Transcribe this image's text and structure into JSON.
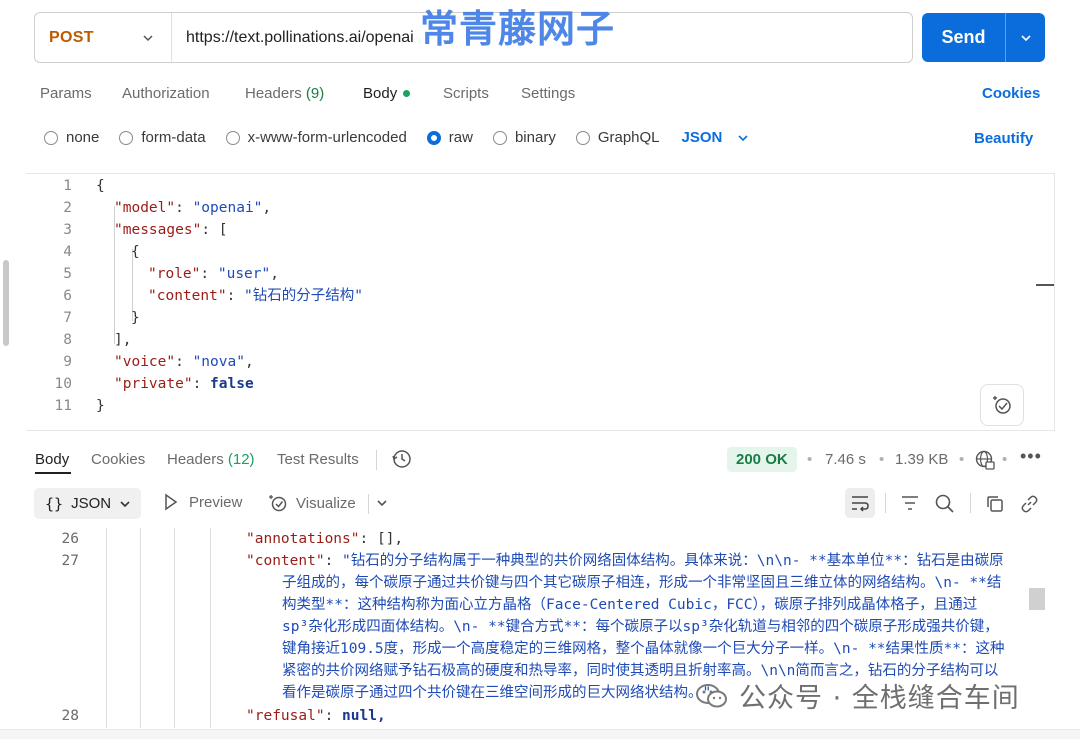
{
  "request": {
    "method": "POST",
    "url": "https://text.pollinations.ai/openai",
    "send_label": "Send"
  },
  "watermark_top": "常青藤网子",
  "tabs": {
    "params": "Params",
    "authorization": "Authorization",
    "headers": "Headers",
    "headers_count": "(9)",
    "body": "Body",
    "scripts": "Scripts",
    "settings": "Settings",
    "cookies": "Cookies"
  },
  "body_types": {
    "none": "none",
    "form_data": "form-data",
    "urlencoded": "x-www-form-urlencoded",
    "raw": "raw",
    "binary": "binary",
    "graphql": "GraphQL",
    "selected": "raw",
    "format": "JSON",
    "beautify": "Beautify"
  },
  "request_body": {
    "line_numbers": [
      "1",
      "2",
      "3",
      "4",
      "5",
      "6",
      "7",
      "8",
      "9",
      "10",
      "11"
    ],
    "open_brace": "{",
    "close_brace": "}",
    "model_key": "\"model\"",
    "model_val": "\"openai\"",
    "messages_key": "\"messages\"",
    "role_key": "\"role\"",
    "role_val": "\"user\"",
    "content_key": "\"content\"",
    "content_val": "\"钻石的分子结构\"",
    "voice_key": "\"voice\"",
    "voice_val": "\"nova\"",
    "private_key": "\"private\"",
    "private_val": "false"
  },
  "response_tabs": {
    "body": "Body",
    "cookies": "Cookies",
    "headers": "Headers",
    "headers_count": "(12)",
    "test_results": "Test Results"
  },
  "response_meta": {
    "status": "200 OK",
    "time": "7.46 s",
    "size": "1.39 KB"
  },
  "response_toolbar": {
    "format": "JSON",
    "preview": "Preview",
    "visualize": "Visualize"
  },
  "response_body": {
    "ln_26": "26",
    "ln_27": "27",
    "ln_28": "28",
    "annotations_key": "\"annotations\"",
    "annotations_val": "[],",
    "content_key": "\"content\"",
    "content_lines": [
      "\"钻石的分子结构属于一种典型的共价网络固体结构。具体来说：\\n\\n- **基本单位**：钻石是由碳原",
      "子组成的，每个碳原子通过共价键与四个其它碳原子相连，形成一个非常坚固且三维立体的网络结构。\\n- **结",
      "构类型**：这种结构称为面心立方晶格（Face-Centered Cubic，FCC），碳原子排列成晶体格子，且通过",
      "sp³杂化形成四面体结构。\\n- **键合方式**：每个碳原子以sp³杂化轨道与相邻的四个碳原子形成强共价键，",
      "键角接近109.5度，形成一个高度稳定的三维网格，整个晶体就像一个巨大分子一样。\\n- **结果性质**：这种",
      "紧密的共价网络赋予钻石极高的硬度和热导率，同时使其透明且折射率高。\\n\\n简而言之，钻石的分子结构可以",
      "看作是碳原子通过四个共价键在三维空间形成的巨大网络状结构。\""
    ],
    "refusal_key": "\"refusal\"",
    "refusal_val": "null,"
  },
  "watermark_bottom": "公众号 · 全栈缝合车间",
  "colors": {
    "accent": "#0b6ddb",
    "method": "#c05a00",
    "status_green": "#1a7d45",
    "json_key": "#9b1c16",
    "json_string": "#1f4bb5"
  }
}
